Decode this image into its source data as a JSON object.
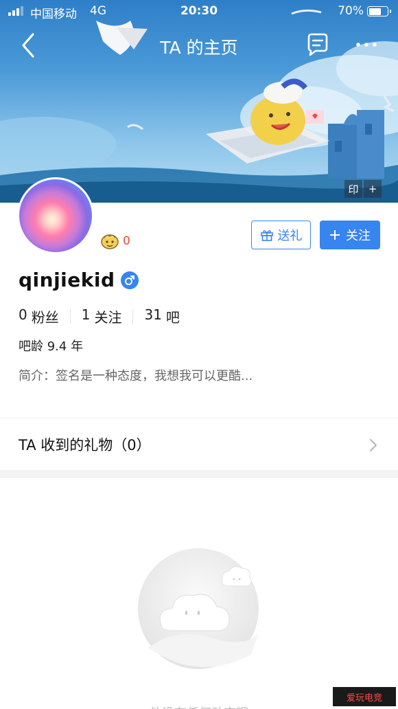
{
  "status_bar": {
    "carrier": "中国移动",
    "network": "4G",
    "time": "20:30",
    "battery_percent_text": "70%",
    "battery_level": 0.7
  },
  "nav": {
    "title": "TA 的主页",
    "back_icon": "chevron-left-icon",
    "message_icon": "message-icon",
    "more_icon": "more-icon"
  },
  "cover": {
    "tools": [
      "印",
      "+"
    ]
  },
  "profile": {
    "level": "0",
    "username": "qinjiekid",
    "gender_icon": "male-icon",
    "gift_button": "送礼",
    "follow_button": "关注",
    "stats": [
      {
        "value": "0",
        "label": "粉丝"
      },
      {
        "value": "1",
        "label": "关注"
      },
      {
        "value": "31",
        "label": "吧"
      }
    ],
    "age": "吧龄 9.4 年",
    "bio": "简介：签名是一种态度，我想我可以更酷..."
  },
  "gifts": {
    "label": "TA 收到的礼物（0）"
  },
  "empty_state": {
    "text": "他没有任何动态哦"
  },
  "watermark": {
    "text": "爱玩电竞"
  },
  "colors": {
    "accent": "#3785ee",
    "level_number": "#e74c3c",
    "sky": "#4b9ad8"
  }
}
